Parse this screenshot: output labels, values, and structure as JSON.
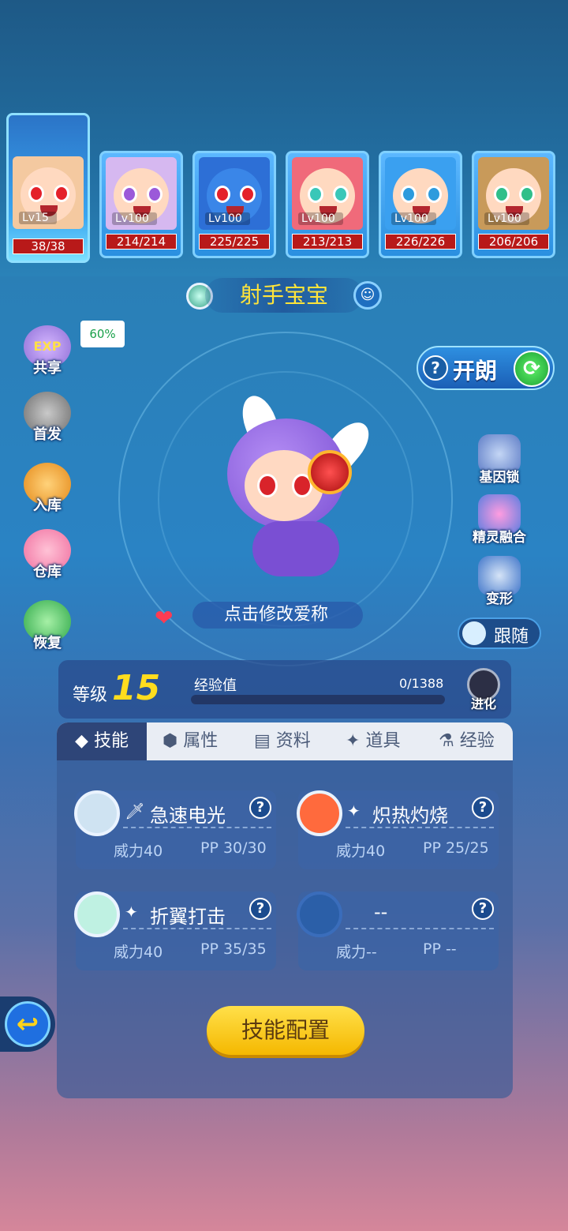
{
  "team": [
    {
      "level": "Lv15",
      "hp": "38/38",
      "active": true
    },
    {
      "level": "Lv100",
      "hp": "214/214"
    },
    {
      "level": "Lv100",
      "hp": "225/225"
    },
    {
      "level": "Lv100",
      "hp": "213/213"
    },
    {
      "level": "Lv100",
      "hp": "226/226"
    },
    {
      "level": "Lv100",
      "hp": "206/206"
    }
  ],
  "pet": {
    "name": "射手宝宝",
    "nickname_prompt": "点击修改爱称"
  },
  "left_menu": {
    "share": "共享",
    "share_exp_icon": "EXP",
    "share_percent": "60%",
    "first": "首发",
    "store": "入库",
    "warehouse": "仓库",
    "recover": "恢复"
  },
  "right_menu": {
    "kailang": "开朗",
    "gene_lock": "基因锁",
    "fusion": "精灵融合",
    "transform": "变形",
    "follow": "跟随"
  },
  "level": {
    "label": "等级",
    "value": "15",
    "exp_label": "经验值",
    "exp_value": "0/1388",
    "evolve": "进化",
    "exp_progress": 0
  },
  "tabs": [
    {
      "label": "技能"
    },
    {
      "label": "属性"
    },
    {
      "label": "资料"
    },
    {
      "label": "道具"
    },
    {
      "label": "经验"
    }
  ],
  "skills": [
    {
      "name": "急速电光",
      "power": "威力40",
      "pp": "PP 30/30",
      "color": "#cfe3f2"
    },
    {
      "name": "炽热灼烧",
      "power": "威力40",
      "pp": "PP 25/25",
      "color": "#ff6a3d"
    },
    {
      "name": "折翼打击",
      "power": "威力40",
      "pp": "PP 35/35",
      "color": "#bff1e2"
    },
    {
      "name": "--",
      "power": "威力--",
      "pp": "PP --",
      "color": "#2b5fa8"
    }
  ],
  "skill_config_button": "技能配置",
  "colors": {
    "accent_yellow": "#ffdd1e",
    "hp_red": "#b81919"
  }
}
